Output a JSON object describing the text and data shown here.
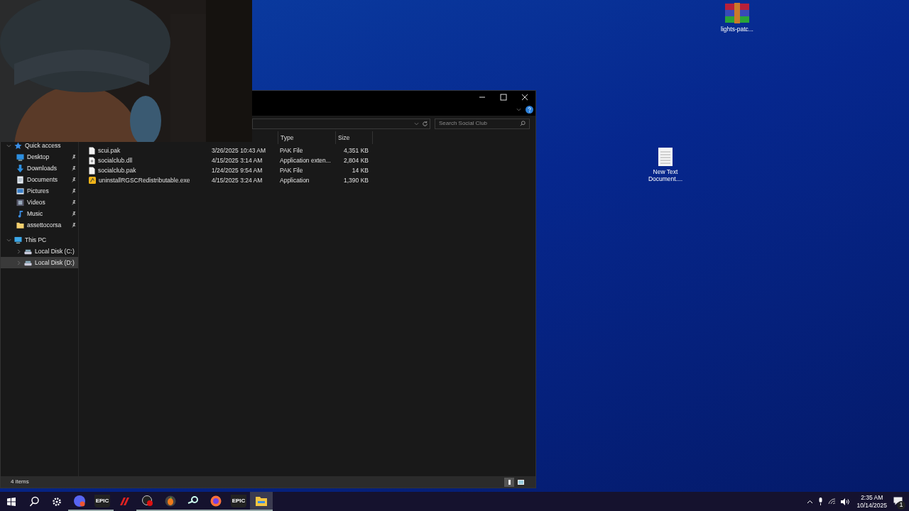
{
  "desktop_icons": [
    {
      "kind": "archive",
      "label": "lights-patc..."
    },
    {
      "kind": "text",
      "label": "New Text Document...."
    }
  ],
  "window": {
    "search": {
      "placeholder": "Search Social Club"
    },
    "nav": [
      {
        "kind": "star",
        "label": "Quick access",
        "expanded": true,
        "selected": false,
        "children": [
          {
            "kind": "desktop",
            "label": "Desktop",
            "pinned": true,
            "selected": false
          },
          {
            "kind": "download",
            "label": "Downloads",
            "pinned": true,
            "selected": false
          },
          {
            "kind": "document",
            "label": "Documents",
            "pinned": true,
            "selected": false
          },
          {
            "kind": "pictures",
            "label": "Pictures",
            "pinned": true,
            "selected": false
          },
          {
            "kind": "videos",
            "label": "Videos",
            "pinned": true,
            "selected": false
          },
          {
            "kind": "music",
            "label": "Music",
            "pinned": true,
            "selected": false
          },
          {
            "kind": "folder",
            "label": "assettocorsa",
            "pinned": true,
            "selected": false
          }
        ]
      },
      {
        "kind": "pc",
        "label": "This PC",
        "expanded": true,
        "selected": false,
        "children": [
          {
            "kind": "disk",
            "label": "Local Disk (C:)",
            "expanded": false,
            "selected": false
          },
          {
            "kind": "disk",
            "label": "Local Disk (D:)",
            "expanded": false,
            "selected": true
          }
        ]
      }
    ],
    "columns": [
      "Type",
      "Size"
    ],
    "files": [
      {
        "kind": "file",
        "name": "scui.pak",
        "date": "3/26/2025 10:43 AM",
        "type": "PAK File",
        "size": "4,351 KB"
      },
      {
        "kind": "dll",
        "name": "socialclub.dll",
        "date": "4/15/2025 3:14 AM",
        "type": "Application exten...",
        "size": "2,804 KB"
      },
      {
        "kind": "file",
        "name": "socialclub.pak",
        "date": "1/24/2025 9:54 AM",
        "type": "PAK File",
        "size": "14 KB"
      },
      {
        "kind": "exe",
        "name": "uninstallRGSCRedistributable.exe",
        "date": "4/15/2025 3:24 AM",
        "type": "Application",
        "size": "1,390 KB"
      }
    ],
    "status": "4 items",
    "views": [
      {
        "kind": "details",
        "selected": true
      },
      {
        "kind": "tiles",
        "selected": false
      }
    ]
  },
  "taskbar": {
    "apps": [
      {
        "kind": "discord",
        "running": true,
        "selected": false
      },
      {
        "kind": "epic",
        "label": "EPIC",
        "running": true,
        "selected": false
      },
      {
        "kind": "racing",
        "running": false,
        "selected": false
      },
      {
        "kind": "obs",
        "running": true,
        "selected": false
      },
      {
        "kind": "fl",
        "running": true,
        "selected": false
      },
      {
        "kind": "steam",
        "running": true,
        "selected": false
      },
      {
        "kind": "firefox",
        "running": true,
        "selected": false
      },
      {
        "kind": "epic",
        "label": "EPIC",
        "running": true,
        "selected": false
      },
      {
        "kind": "explorer",
        "running": true,
        "selected": true
      }
    ],
    "time": "2:35 AM",
    "date": "10/14/2025",
    "notifications": "1"
  }
}
